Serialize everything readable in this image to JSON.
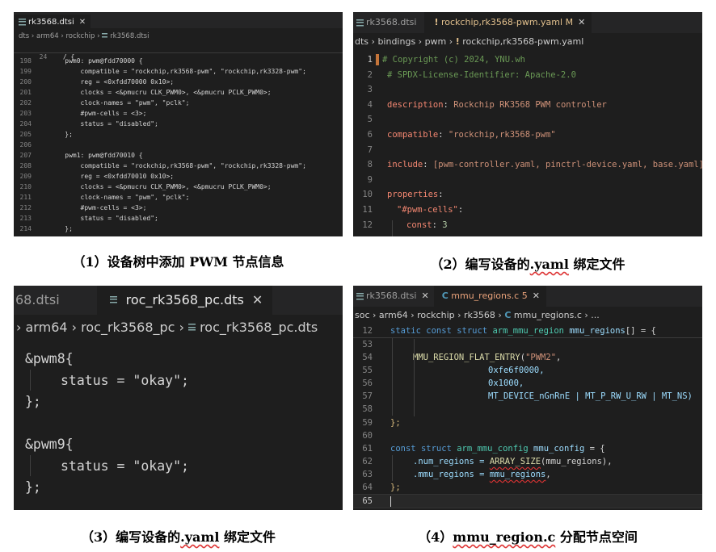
{
  "p1": {
    "tab": "rk3568.dtsi",
    "crumb": [
      "dts",
      "arm64",
      "rockchip",
      "rk3568.dtsi"
    ],
    "sticky": {
      "num": "24",
      "text": "  / {"
    },
    "lines": [
      {
        "n": "198",
        "t": "    pwm0: pwm@fdd70000 {"
      },
      {
        "n": "199",
        "t": "        compatible = \"rockchip,rk3568-pwm\", \"rockchip,rk3328-pwm\";"
      },
      {
        "n": "200",
        "t": "        reg = <0xfdd70000 0x10>;"
      },
      {
        "n": "201",
        "t": "        clocks = <&pmucru CLK_PWM0>, <&pmucru PCLK_PWM0>;"
      },
      {
        "n": "202",
        "t": "        clock-names = \"pwm\", \"pclk\";"
      },
      {
        "n": "203",
        "t": "        #pwm-cells = <3>;"
      },
      {
        "n": "204",
        "t": "        status = \"disabled\";"
      },
      {
        "n": "205",
        "t": "    };"
      },
      {
        "n": "206",
        "t": ""
      },
      {
        "n": "207",
        "t": "    pwm1: pwm@fdd70010 {"
      },
      {
        "n": "208",
        "t": "        compatible = \"rockchip,rk3568-pwm\", \"rockchip,rk3328-pwm\";"
      },
      {
        "n": "209",
        "t": "        reg = <0xfdd70010 0x10>;"
      },
      {
        "n": "210",
        "t": "        clocks = <&pmucru CLK_PWM0>, <&pmucru PCLK_PWM0>;"
      },
      {
        "n": "211",
        "t": "        clock-names = \"pwm\", \"pclk\";"
      },
      {
        "n": "212",
        "t": "        #pwm-cells = <3>;"
      },
      {
        "n": "213",
        "t": "        status = \"disabled\";"
      },
      {
        "n": "214",
        "t": "    };"
      }
    ],
    "caption": "（1）设备树中添加 PWM 节点信息"
  },
  "p2": {
    "tab1": "rk3568.dtsi",
    "tab2": "rockchip,rk3568-pwm.yaml",
    "tab2_badge": "M",
    "crumb": [
      "dts",
      "bindings",
      "pwm",
      "rockchip,rk3568-pwm.yaml"
    ],
    "l1": {
      "n": "1",
      "t": "# Copyright (c) 2024, YNU.wh"
    },
    "l2": {
      "n": "2",
      "t": "# SPDX-License-Identifier: Apache-2.0"
    },
    "l3": {
      "n": "3"
    },
    "l4": {
      "n": "4",
      "k": "description",
      "v": "Rockchip RK3568 PWM controller"
    },
    "l5": {
      "n": "5"
    },
    "l6": {
      "n": "6",
      "k": "compatible",
      "v": "\"rockchip,rk3568-pwm\""
    },
    "l7": {
      "n": "7"
    },
    "l8": {
      "n": "8",
      "k": "include",
      "v": "[pwm-controller.yaml, pinctrl-device.yaml, base.yaml]"
    },
    "l9": {
      "n": "9"
    },
    "l10": {
      "n": "10",
      "k": "properties"
    },
    "l11": {
      "n": "11",
      "k": "\"#pwm-cells\""
    },
    "l12": {
      "n": "12",
      "k": "const",
      "v": "3"
    },
    "sep": ": ",
    "colon": ":",
    "caption_pre": "（2）编写设备的",
    "caption_yaml": ".yaml",
    "caption_post": " 绑定文件"
  },
  "p3": {
    "tab1": "68.dtsi",
    "tab2": "roc_rk3568_pc.dts",
    "crumb": [
      "arm64",
      "roc_rk3568_pc",
      "roc_rk3568_pc.dts"
    ],
    "a_open": "&pwm8{",
    "a_status": "status = \"okay\";",
    "a_close": "};",
    "b_open": "&pwm9{",
    "b_status": "status = \"okay\";",
    "b_close": "};",
    "caption_pre": "（3）编写设备的",
    "caption_yaml": ".yaml",
    "caption_post": " 绑定文件"
  },
  "p4": {
    "tab1": "rk3568.dtsi",
    "tab2": "mmu_regions.c",
    "tab2_badge": "5",
    "crumb": [
      "soc",
      "arm64",
      "rockchip",
      "rk3568",
      "mmu_regions.c",
      "..."
    ],
    "sticky": {
      "n": "12",
      "kw1": "static",
      "kw2": "const",
      "kw3": "struct",
      "type": "arm_mmu_region",
      "var": "mmu_regions",
      "rest": "[] = {"
    },
    "l53": {
      "n": "53"
    },
    "l54": {
      "n": "54",
      "fn": "MMU_REGION_FLAT_ENTRY",
      "str": "\"PWM2\"",
      "rest": ","
    },
    "l55": {
      "n": "55",
      "v": "0xfe6f0000,"
    },
    "l56": {
      "n": "56",
      "v": "0x1000,"
    },
    "l57": {
      "n": "57",
      "v": "MT_DEVICE_nGnRnE | MT_P_RW_U_RW | MT_NS)"
    },
    "l58": {
      "n": "58"
    },
    "l59": {
      "n": "59",
      "t": "};"
    },
    "l60": {
      "n": "60"
    },
    "l61": {
      "n": "61",
      "kw1": "const",
      "kw2": "struct",
      "type": "arm_mmu_config",
      "var": "mmu_config",
      "rest": " = {"
    },
    "l62": {
      "n": "62",
      "a": ".num_regions = ",
      "fn": "ARRAY_SIZE",
      "b": "(mmu_regions),"
    },
    "l63": {
      "n": "63",
      "a": ".mmu_regions = ",
      "b": "mmu_regions",
      "c": ","
    },
    "l64": {
      "n": "64",
      "t": "};"
    },
    "l65": {
      "n": "65"
    },
    "caption_pre": "（4）",
    "caption_file": "mmu_region.c",
    "caption_post": " 分配节点空间"
  },
  "icons": {
    "file": "file-lines-icon",
    "yaml": "exclamation-icon",
    "c": "c-language-icon",
    "close": "close-icon",
    "chevron": "chevron-right-icon"
  },
  "colors": {
    "editor_bg": "#1e1e1e",
    "tabbar_bg": "#252526",
    "keyword": "#569cd6",
    "string": "#ce9178",
    "comment": "#6a9955",
    "yaml_key": "#f48771",
    "type": "#4ec9b0",
    "function": "#dcdcaa"
  }
}
